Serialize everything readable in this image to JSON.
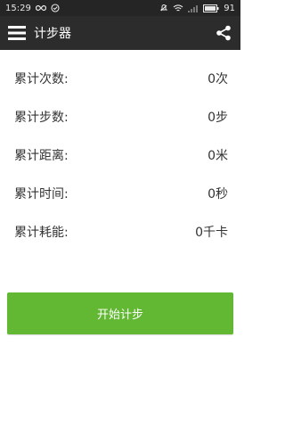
{
  "status_bar": {
    "time": "15:29",
    "battery": "91",
    "icons": [
      "infinity-icon",
      "check-circle-icon",
      "no-notification-icon",
      "wifi-icon",
      "signal-icon",
      "battery-icon"
    ]
  },
  "app_bar": {
    "title": "计步器",
    "menu_icon": "hamburger-menu-icon",
    "share_icon": "share-icon"
  },
  "stats": [
    {
      "label": "累计次数:",
      "value": "0次"
    },
    {
      "label": "累计步数:",
      "value": "0步"
    },
    {
      "label": "累计距离:",
      "value": "0米"
    },
    {
      "label": "累计时间:",
      "value": "0秒"
    },
    {
      "label": "累计耗能:",
      "value": "0千卡"
    }
  ],
  "start_button": {
    "label": "开始计步"
  },
  "colors": {
    "status_bar_bg": "#252525",
    "app_bar_bg": "#2c2c2c",
    "accent_green": "#62b832",
    "text": "#333333"
  }
}
